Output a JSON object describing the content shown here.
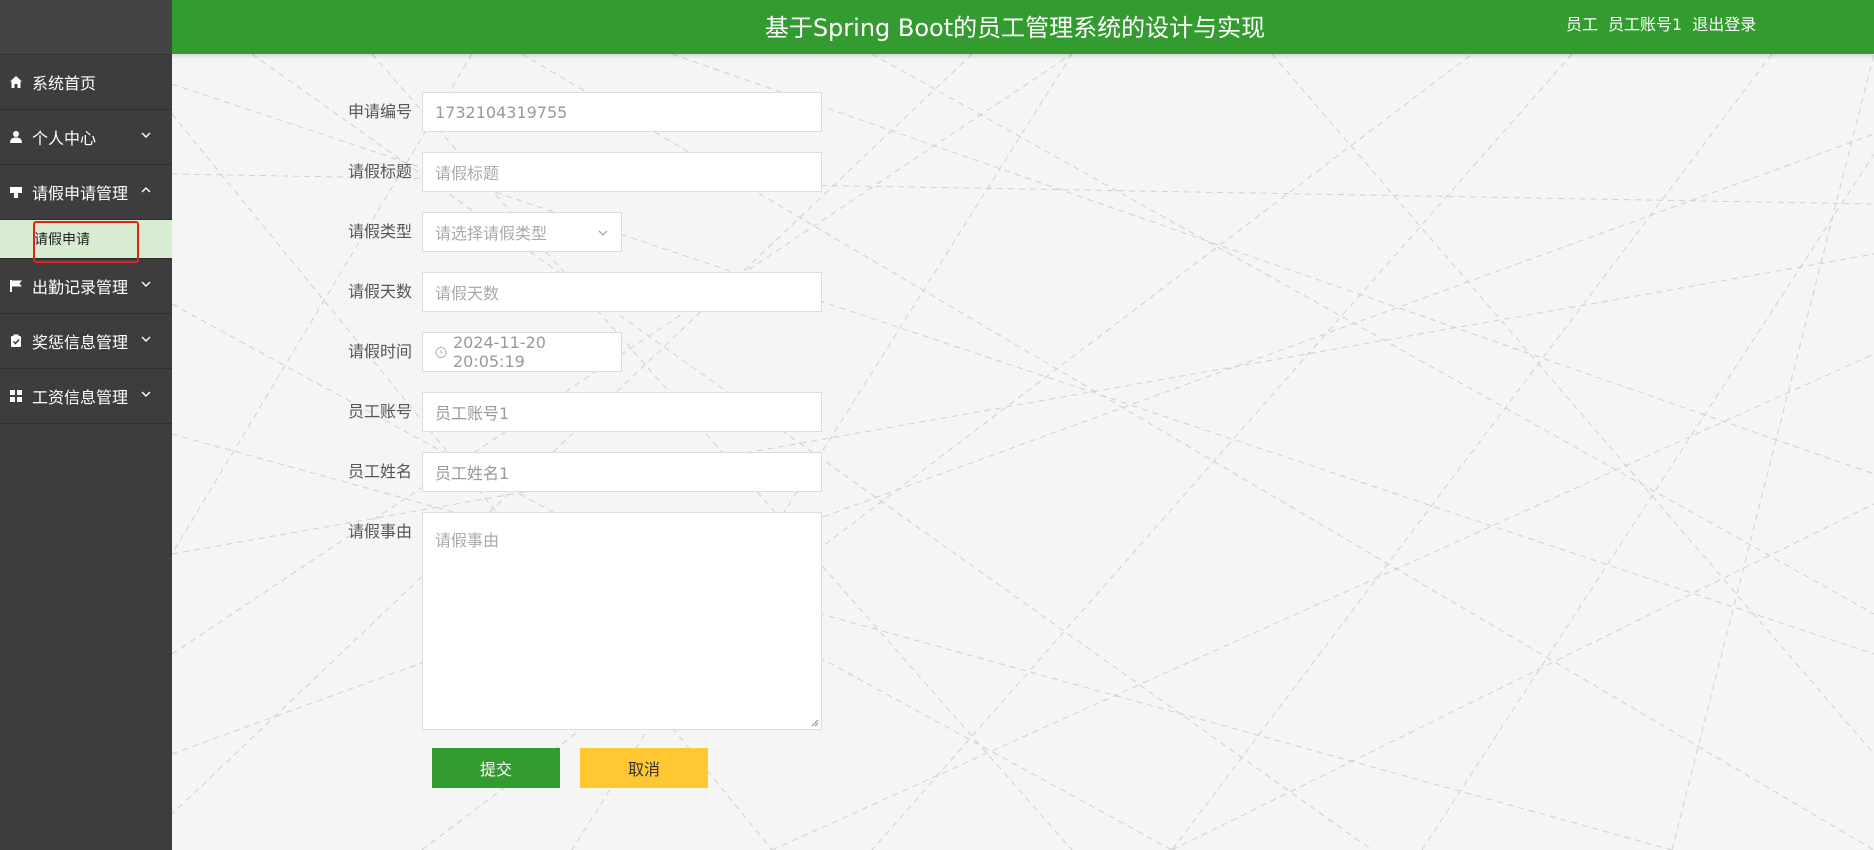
{
  "header": {
    "title": "基于Spring Boot的员工管理系统的设计与实现",
    "role": "员工",
    "username": "员工账号1",
    "logout": "退出登录"
  },
  "sidebar": {
    "items": [
      {
        "label": "系统首页",
        "icon": "home-icon"
      },
      {
        "label": "个人中心",
        "icon": "user-icon",
        "expanded": false
      },
      {
        "label": "请假申请管理",
        "icon": "leave-icon",
        "expanded": true
      },
      {
        "label": "出勤记录管理",
        "icon": "flag-icon",
        "expanded": false
      },
      {
        "label": "奖惩信息管理",
        "icon": "clipboard-icon",
        "expanded": false
      },
      {
        "label": "工资信息管理",
        "icon": "grid-icon",
        "expanded": false
      }
    ],
    "sub_items": [
      {
        "label": "请假申请",
        "selected": true
      }
    ]
  },
  "form": {
    "fields": [
      {
        "label": "申请编号",
        "value": "1732104319755",
        "placeholder": ""
      },
      {
        "label": "请假标题",
        "value": "",
        "placeholder": "请假标题"
      },
      {
        "label": "请假类型",
        "value": "",
        "placeholder": "请选择请假类型"
      },
      {
        "label": "请假天数",
        "value": "",
        "placeholder": "请假天数"
      },
      {
        "label": "请假时间",
        "value": "2024-11-20 20:05:19",
        "placeholder": ""
      },
      {
        "label": "员工账号",
        "value": "员工账号1",
        "placeholder": ""
      },
      {
        "label": "员工姓名",
        "value": "员工姓名1",
        "placeholder": ""
      },
      {
        "label": "请假事由",
        "value": "",
        "placeholder": "请假事由"
      }
    ],
    "submit": "提交",
    "cancel": "取消"
  },
  "colors": {
    "header_bg": "#339b30",
    "sidebar_bg": "#3d3d3d",
    "submit_bg": "#339b30",
    "cancel_bg": "#ffc832",
    "selected_bg": "#d8ecd1",
    "highlight_border": "#e2231a"
  }
}
